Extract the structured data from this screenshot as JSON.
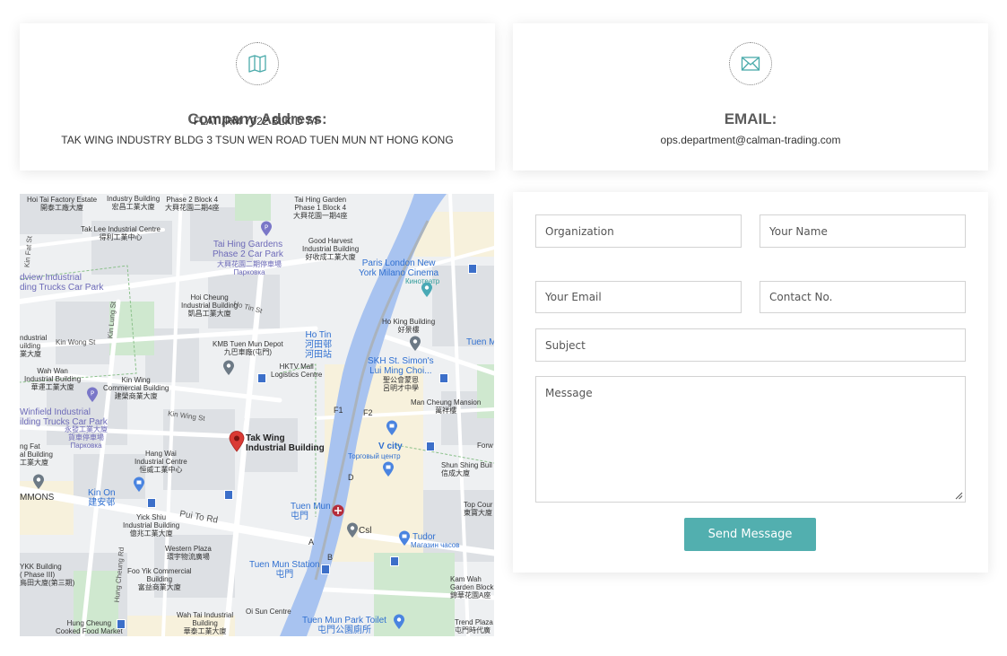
{
  "address_card": {
    "icon": "map-icon",
    "title": "Company Address:",
    "line1": "FLAT /RM 7022 BLK D 7/F",
    "line2": "TAK WING INDUSTRY BLDG 3 TSUN WEN ROAD TUEN MUN NT HONG KONG"
  },
  "email_card": {
    "icon": "envelope-icon",
    "title": "EMAIL:",
    "email": "ops.department@calman-trading.com"
  },
  "map": {
    "pin_label": "Tak Wing\nIndustrial Building",
    "labels": {
      "hoi_tai": "Hoi Tai Factory Estate\n開泰工廠大廈",
      "industry_bldg": "Industry Building\n宏昌工業大廈",
      "tai_hing_b4": "Phase 2 Block 4\n大興花園二期4座",
      "tai_hing_b1": "Tai Hing Garden\nPhase 1 Block 4\n大興花園一期4座",
      "tak_lee": "Tak Lee Industrial Centre\n得利工業中心",
      "tai_hing_carpark": "Tai Hing Gardens\nPhase 2 Car Park",
      "tai_hing_carpark_cn": "大興花園二期停車場\nПарковка",
      "good_harvest": "Good Harvest\nIndustrial Building\n好收成工業大廈",
      "paris_london": "Paris London New\nYork Milano Cinema",
      "kinoteatr": "Кинотеатр",
      "view_industrial": "dview Industrial\nding Trucks Car Park",
      "hoi_cheung": "Hoi Cheung\nIndustrial Building\n凱昌工業大廈",
      "kmb_depot": "KMB Tuen Mun Depot\n九巴車廠(屯門)",
      "ho_tin_st": "Ho Tin St",
      "ho_tin": "Ho Tin\n河田邨\n河田站",
      "ho_king": "Ho King Building\n好景樓",
      "tuen_mun_right": "Tuen M",
      "industrial_left": "ndustrial\nuilding\n業大廈",
      "kin_wong_st": "Kin Wong St",
      "hktv_mall": "HKTV Mall\nLogistics Centre",
      "skh_st_simon": "SKH St. Simon's\nLui Ming Choi...",
      "skh_cn": "聖公會蒙恩\n呂明才中學",
      "wah_wan": "Wah Wan\nIndustrial Building\n華運工業大廈",
      "kin_wing": "Kin Wing\nCommercial Building\n建榮商業大廈",
      "winfield": "Winfield Industrial\nilding Trucks Car Park",
      "winfield_cn": "永發工業大廈\n貨車停車場\nПарковка",
      "kin_wing_st": "Kin Wing St",
      "man_cheung": "Man Cheung Mansion\n萬祥樓",
      "f1": "F1",
      "f2": "F2",
      "v_city": "V city",
      "v_city_ru": "Торговый центр",
      "forw": "Forw",
      "ng_fat": "ng Fat\nal Building\n工業大廈",
      "hang_wai": "Hang Wai\nIndustrial Centre\n恒威工業中心",
      "shun_shing": "Shun Shing Buil\n信成大廈",
      "mmons": "MMONS",
      "kin_on": "Kin On\n建安邨",
      "d_exit": "D",
      "tuen_mun_station_cn": "Tuen Mun\n屯門",
      "top_cour": "Top Cour\n東寶大廈",
      "pui_to_rd": "Pui To Rd",
      "yick_shiu": "Yick Shiu\nIndustrial Building\n億兆工業大廈",
      "csl": "Csl",
      "tudor": "Tudor",
      "tudor_ru": "Магазин часов",
      "western_plaza": "Western Plaza\n環宇物流廣場",
      "a_exit": "A",
      "b_exit": "B",
      "ykk": "YKK Building\n( Phase III)\n鳥田大廈(第三期)",
      "foo_yik": "Foo Yik Commercial\nBuilding\n富益商業大廈",
      "tuen_mun_station": "Tuen Mun Station\n屯門",
      "hung_cheung_rd": "Hung Cheung Rd",
      "kam_wah": "Kam Wah\nGarden Block A\n錦華花園A座",
      "wah_tai": "Wah Tai Industrial\nBuilding\n華泰工業大廈",
      "oi_sun": "Oi Sun Centre",
      "tuen_mun_park_toilet": "Tuen Mun Park Toilet\n屯門公園廁所",
      "trend_plaza": "Trend Plaza\n屯門時代廣",
      "hung_cheung_food": "Hung Cheung\nCooked Food Market",
      "kin_lung_st": "Kin Lung St",
      "kin_fat_st": "Kin Fat St"
    }
  },
  "form": {
    "organization_placeholder": "Organization",
    "name_placeholder": "Your Name",
    "email_placeholder": "Your Email",
    "contact_placeholder": "Contact No.",
    "subject_placeholder": "Subject",
    "message_placeholder": "Message",
    "submit_label": "Send Message"
  },
  "colors": {
    "accent": "#52afaf",
    "pin": "#d93a34",
    "water": "#a8c3f0"
  }
}
